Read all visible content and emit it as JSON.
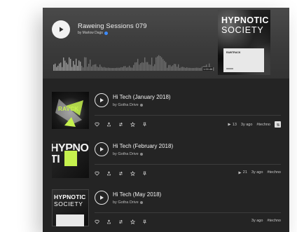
{
  "hero": {
    "title": "Raweing Sessions 079",
    "artist": "by Marlow Dags",
    "time": "1:00:46",
    "cover_line1": "HYPNOTIC",
    "cover_line2": "SOCIETY",
    "cover_card_label": "RAWTRACK"
  },
  "tracks": [
    {
      "title": "Hi Tech (January 2018)",
      "artist": "by Gotha Drive",
      "plays": "13",
      "age": "3y ago",
      "tag": "#techno",
      "art_text": "RAVCK"
    },
    {
      "title": "Hi Tech (February 2018)",
      "artist": "by Gotha Drive",
      "plays": "21",
      "age": "3y ago",
      "tag": "#techno",
      "art_text": "HYPNOTI"
    },
    {
      "title": "Hi Tech (May 2018)",
      "artist": "by Gotha Drive",
      "plays": "",
      "age": "3y ago",
      "tag": "#techno",
      "art_text1": "HYPNOTIC",
      "art_text2": "SOCIETY"
    }
  ],
  "icons": [
    "play-icon",
    "heart-icon",
    "share-icon",
    "repost-icon",
    "star-icon",
    "pin-icon",
    "verified-icon",
    "more-icon"
  ],
  "colors": {
    "panel": "#242424",
    "hero": "#3d3d3d",
    "text": "#f2f2f2",
    "accent_green": "#c6f24e",
    "verified": "#3d8bff"
  }
}
